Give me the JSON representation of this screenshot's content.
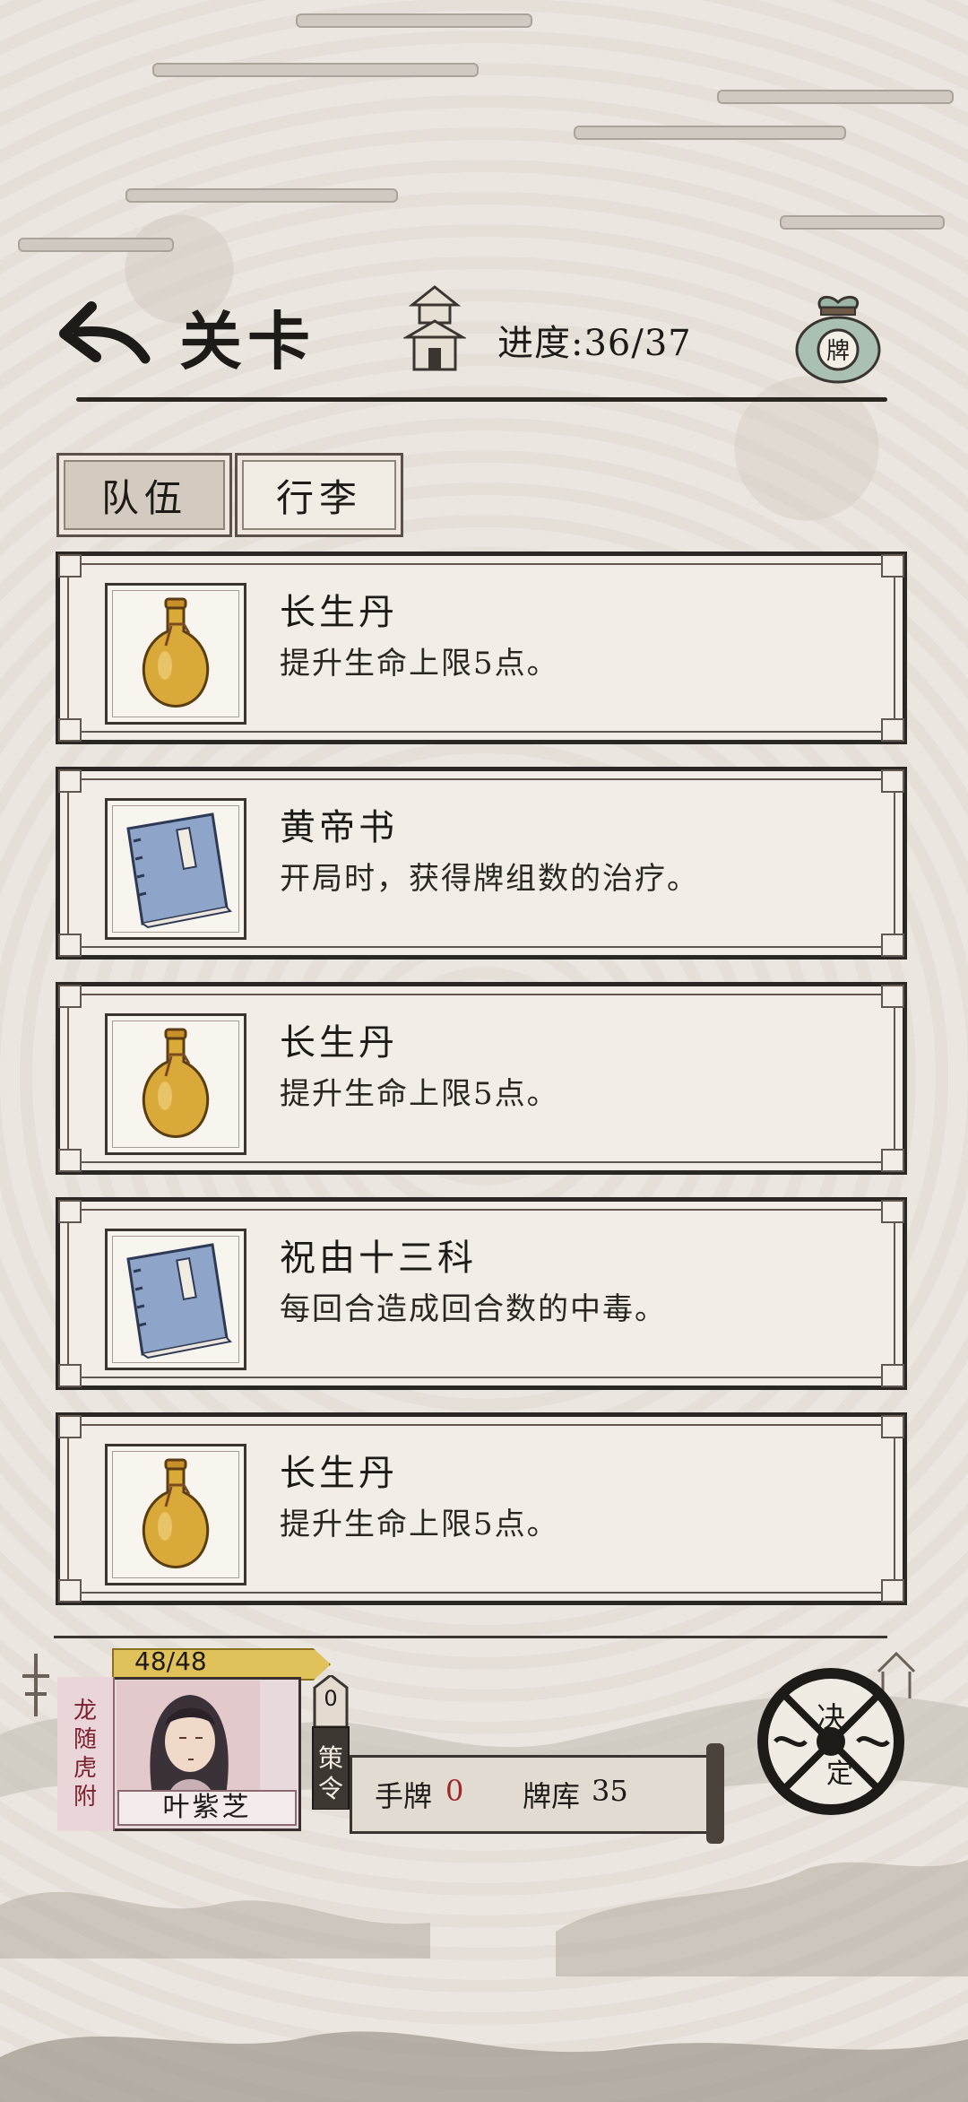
{
  "header": {
    "title": "关卡",
    "progress": "进度:36/37",
    "bag_label": "牌"
  },
  "tabs": [
    {
      "label": "队伍",
      "active": true
    },
    {
      "label": "行李",
      "active": false
    }
  ],
  "items": [
    {
      "name": "长生丹",
      "desc": "提升生命上限5点。",
      "icon": "gourd-icon"
    },
    {
      "name": "黄帝书",
      "desc": "开局时，获得牌组数的治疗。",
      "icon": "book-icon"
    },
    {
      "name": "长生丹",
      "desc": "提升生命上限5点。",
      "icon": "gourd-icon"
    },
    {
      "name": "祝由十三科",
      "desc": "每回合造成回合数的中毒。",
      "icon": "book-icon"
    },
    {
      "name": "长生丹",
      "desc": "提升生命上限5点。",
      "icon": "gourd-icon"
    }
  ],
  "hero": {
    "hp": "48/48",
    "faction_chars": [
      "龙",
      "随",
      "虎",
      "附"
    ],
    "name": "叶紫芝"
  },
  "tactic": {
    "count": "0",
    "label_chars": [
      "策",
      "令"
    ]
  },
  "hand": {
    "label": "手牌",
    "count": "0"
  },
  "deck": {
    "label": "牌库",
    "count": "35"
  },
  "seal": {
    "top": "决",
    "bottom": "定"
  },
  "colors": {
    "gold": "#d9a93a",
    "book_blue": "#8ea4c8",
    "hp_yellow": "#e0c15a",
    "accent_red": "#a02828"
  }
}
